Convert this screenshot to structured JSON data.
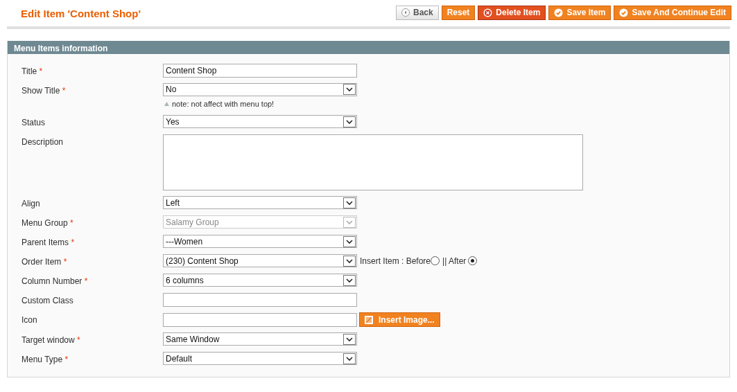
{
  "page_title": "Edit Item 'Content Shop'",
  "actions": [
    {
      "label": "Back",
      "kind": "back"
    },
    {
      "label": "Reset",
      "kind": "plain"
    },
    {
      "label": "Delete Item",
      "kind": "delete"
    },
    {
      "label": "Save Item",
      "kind": "save"
    },
    {
      "label": "Save And Continue Edit",
      "kind": "save"
    }
  ],
  "section_title": "Menu Items information",
  "fields": [
    {
      "label": "Title",
      "required_mark": "*",
      "kind": "text",
      "value": "Content Shop"
    },
    {
      "label": "Show Title",
      "required_mark": "*",
      "kind": "select",
      "value": "No",
      "note": "note: not affect with menu top!"
    },
    {
      "label": "Status",
      "kind": "select",
      "value": "Yes"
    },
    {
      "label": "Description",
      "kind": "textarea"
    },
    {
      "label": "Align",
      "kind": "select",
      "value": "Left"
    },
    {
      "label": "Menu Group",
      "required_mark": "*",
      "kind": "select",
      "value": "Salamy Group",
      "disabled": true
    },
    {
      "label": "Parent Items",
      "required_mark": "*",
      "kind": "select",
      "value": "---Women"
    },
    {
      "label": "Order Item",
      "required_mark": "*",
      "kind": "select",
      "value": "(230) Content Shop",
      "insert": {
        "label": "Insert Item : Before",
        "separator": "|| After",
        "before_selected": false,
        "after_selected": true
      }
    },
    {
      "label": "Column Number",
      "required_mark": "*",
      "kind": "select",
      "value": "6 columns"
    },
    {
      "label": "Custom Class",
      "kind": "text"
    },
    {
      "label": "Icon",
      "kind": "text",
      "button": "Insert Image..."
    },
    {
      "label": "Target window",
      "required_mark": "*",
      "kind": "select",
      "value": "Same Window"
    },
    {
      "label": "Menu Type",
      "required_mark": "*",
      "kind": "select",
      "value": "Default"
    }
  ]
}
